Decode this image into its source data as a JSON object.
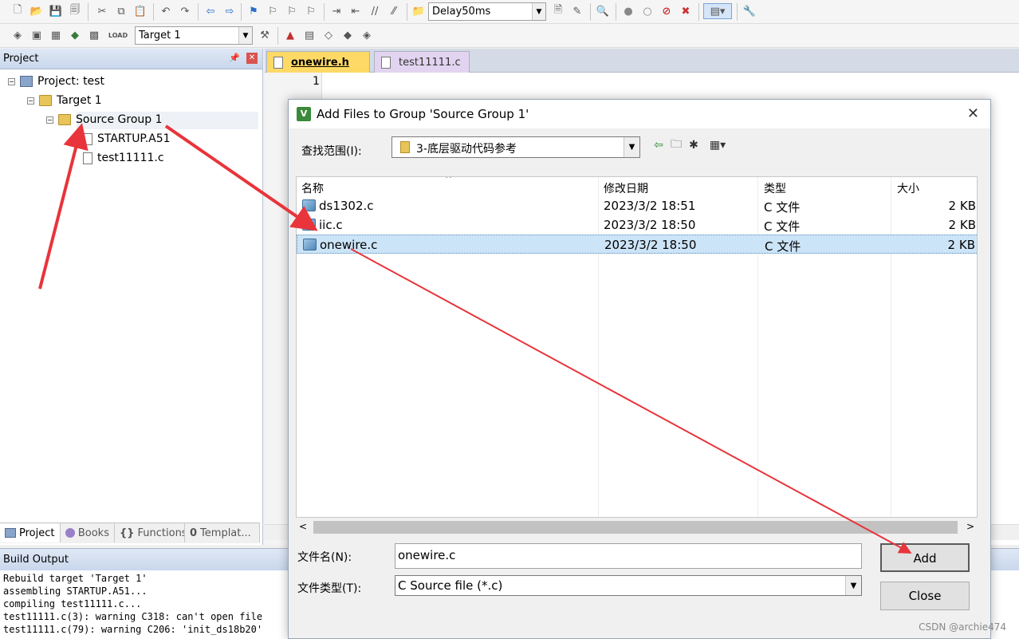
{
  "toolbar": {
    "function_combo": "Delay50ms",
    "target_combo": "Target 1",
    "load_label": "LOAD"
  },
  "project": {
    "title": "Project",
    "tree": {
      "project": "Project: test",
      "target": "Target 1",
      "group": "Source Group 1",
      "files": [
        "STARTUP.A51",
        "test11111.c"
      ]
    },
    "tabs": [
      "Project",
      "Books",
      "Functions",
      "Templat..."
    ]
  },
  "editor": {
    "tabs": [
      "onewire.h",
      "test11111.c"
    ],
    "line_number": "1"
  },
  "build": {
    "title": "Build Output",
    "lines": [
      "Rebuild target 'Target 1'",
      "assembling STARTUP.A51...",
      "compiling test11111.c...",
      "test11111.c(3): warning C318: can't open file",
      "test11111.c(79): warning C206: 'init_ds18b20'"
    ]
  },
  "dialog": {
    "title": "Add Files to Group 'Source Group 1'",
    "lookin_label": "查找范围(I):",
    "lookin_value": "3-底层驱动代码参考",
    "columns": {
      "name": "名称",
      "date": "修改日期",
      "type": "类型",
      "size": "大小"
    },
    "files": [
      {
        "name": "ds1302.c",
        "date": "2023/3/2 18:51",
        "type": "C 文件",
        "size": "2 KB"
      },
      {
        "name": "iic.c",
        "date": "2023/3/2 18:50",
        "type": "C 文件",
        "size": "2 KB"
      },
      {
        "name": "onewire.c",
        "date": "2023/3/2 18:50",
        "type": "C 文件",
        "size": "2 KB"
      }
    ],
    "filename_label": "文件名(N):",
    "filename_value": "onewire.c",
    "filetype_label": "文件类型(T):",
    "filetype_value": "C Source file (*.c)",
    "add_label": "Add",
    "close_label": "Close"
  },
  "watermark": "CSDN @archie474",
  "colors": {
    "annotation": "#e8343a",
    "selection": "#cce4f7",
    "active_tab": "#ffd966"
  }
}
